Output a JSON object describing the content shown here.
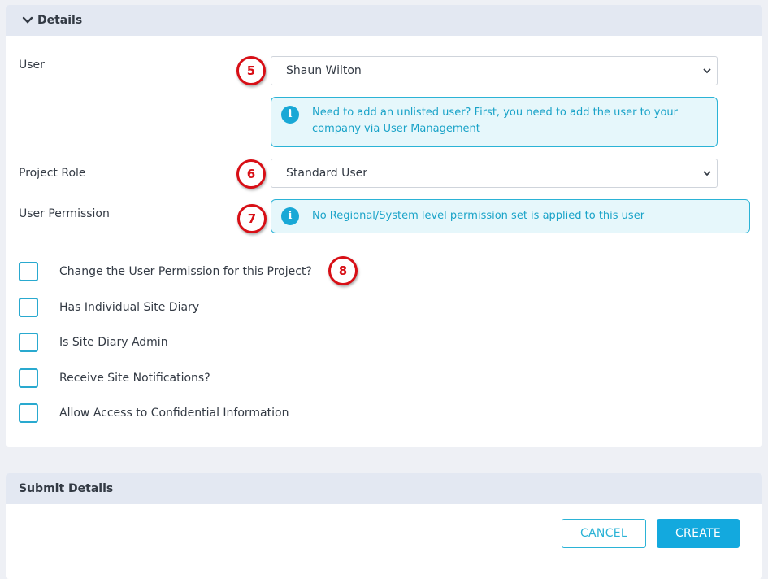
{
  "details": {
    "title": "Details",
    "user_label": "User",
    "user_value": "Shaun Wilton",
    "unlisted_line1": "Need to add an unlisted user? First, you need to add the user to your",
    "unlisted_line2": "company via User Management",
    "project_role_label": "Project Role",
    "project_role_value": "Standard User",
    "user_permission_label": "User Permission",
    "permission_info": "No Regional/System level permission set is applied to this user",
    "checkboxes": [
      {
        "label": "Change the User Permission for this Project?",
        "checked": false
      },
      {
        "label": "Has Individual Site Diary",
        "checked": false
      },
      {
        "label": "Is Site Diary Admin",
        "checked": false
      },
      {
        "label": "Receive Site Notifications?",
        "checked": false
      },
      {
        "label": "Allow Access to Confidential Information",
        "checked": false
      }
    ]
  },
  "annotations": {
    "b5": "5",
    "b6": "6",
    "b7": "7",
    "b8": "8"
  },
  "submit": {
    "title": "Submit Details",
    "cancel_label": "CANCEL",
    "create_label": "CREATE"
  },
  "colors": {
    "accent": "#13a9de",
    "info_text": "#1aa3c8",
    "info_bg": "#e6f7fb",
    "badge_red": "#d80f16",
    "header_bg": "#e3e8f2"
  },
  "icons": [
    "chevron-down-icon",
    "info-icon",
    "caret-down-icon"
  ]
}
